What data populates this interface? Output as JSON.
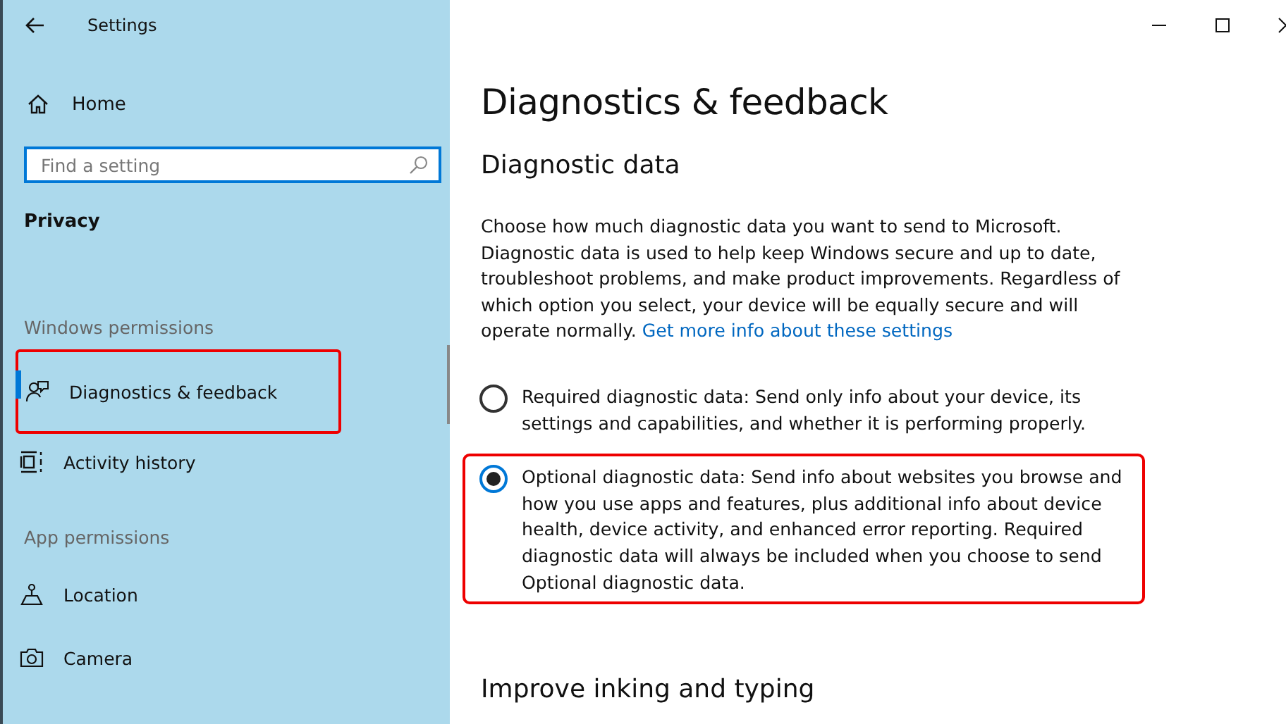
{
  "window": {
    "title": "Settings"
  },
  "sidebar": {
    "home": "Home",
    "search": {
      "placeholder": "Find a setting"
    },
    "section": "Privacy",
    "groups": [
      {
        "heading": "Windows permissions",
        "items": [
          {
            "label": "Diagnostics & feedback",
            "kind": "feedback",
            "selected": true,
            "highlighted": true
          },
          {
            "label": "Activity history",
            "kind": "activity",
            "selected": false,
            "highlighted": false
          }
        ]
      },
      {
        "heading": "App permissions",
        "items": [
          {
            "label": "Location",
            "kind": "location",
            "selected": false,
            "highlighted": false
          },
          {
            "label": "Camera",
            "kind": "camera",
            "selected": false,
            "highlighted": false
          }
        ]
      }
    ]
  },
  "page": {
    "title": "Diagnostics & feedback",
    "section": "Diagnostic data",
    "description": "Choose how much diagnostic data you want to send to Microsoft. Diagnostic data is used to help keep Windows secure and up to date, troubleshoot problems, and make product improvements. Regardless of which option you select, your device will be equally secure and will operate normally.",
    "link": "Get more info about these settings",
    "options": [
      {
        "label": "Required diagnostic data: Send only info about your device, its settings and capabilities, and whether it is performing properly.",
        "selected": false,
        "highlighted": false
      },
      {
        "label": "Optional diagnostic data: Send info about websites you browse and how you use apps and features, plus additional info about device health, device activity, and enhanced error reporting. Required diagnostic data will always be included when you choose to send Optional diagnostic data.",
        "selected": true,
        "highlighted": true
      }
    ],
    "next_section": "Improve inking and typing"
  }
}
